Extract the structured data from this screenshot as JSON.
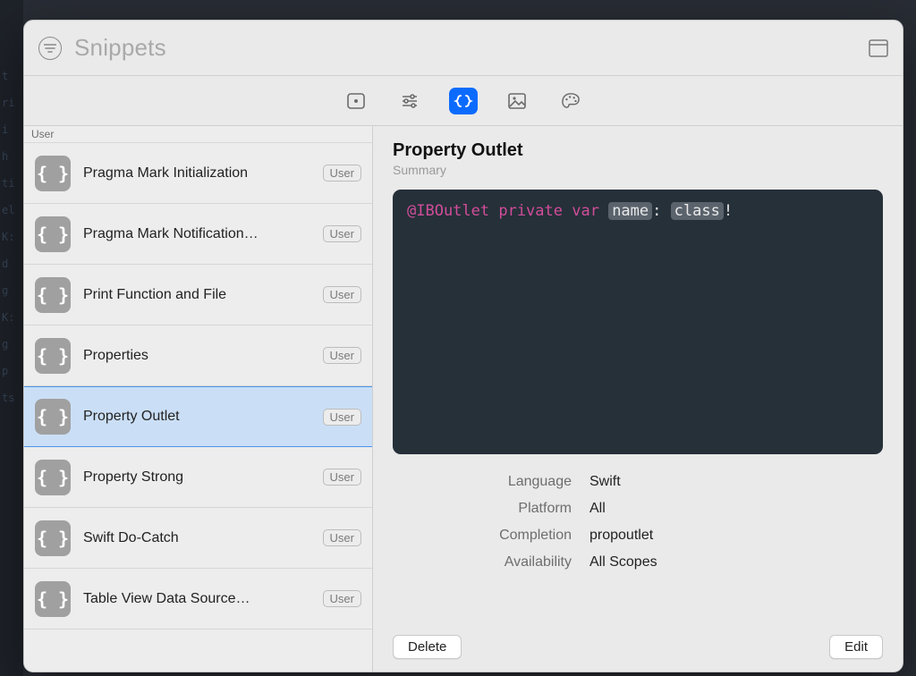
{
  "header": {
    "search_placeholder": "Snippets"
  },
  "categories": [
    {
      "id": "views",
      "selected": false
    },
    {
      "id": "controls",
      "selected": false
    },
    {
      "id": "code",
      "selected": true
    },
    {
      "id": "media",
      "selected": false
    },
    {
      "id": "color",
      "selected": false
    }
  ],
  "list": {
    "section_label": "User",
    "items": [
      {
        "name": "Pragma Mark Initialization",
        "tag": "User",
        "selected": false
      },
      {
        "name": "Pragma Mark Notification…",
        "tag": "User",
        "selected": false
      },
      {
        "name": "Print Function and File",
        "tag": "User",
        "selected": false
      },
      {
        "name": "Properties",
        "tag": "User",
        "selected": false
      },
      {
        "name": "Property Outlet",
        "tag": "User",
        "selected": true
      },
      {
        "name": "Property Strong",
        "tag": "User",
        "selected": false
      },
      {
        "name": "Swift Do-Catch",
        "tag": "User",
        "selected": false
      },
      {
        "name": "Table View Data Source…",
        "tag": "User",
        "selected": false
      }
    ]
  },
  "detail": {
    "title": "Property Outlet",
    "subtitle": "Summary",
    "code": {
      "prefix_keyword": "@IBOutlet private var",
      "placeholder1": "name",
      "sep": ": ",
      "placeholder2": "class",
      "suffix": "!"
    },
    "meta": {
      "language_label": "Language",
      "language_value": "Swift",
      "platform_label": "Platform",
      "platform_value": "All",
      "completion_label": "Completion",
      "completion_value": "propoutlet",
      "availability_label": "Availability",
      "availability_value": "All Scopes"
    },
    "actions": {
      "delete": "Delete",
      "edit": "Edit"
    }
  }
}
